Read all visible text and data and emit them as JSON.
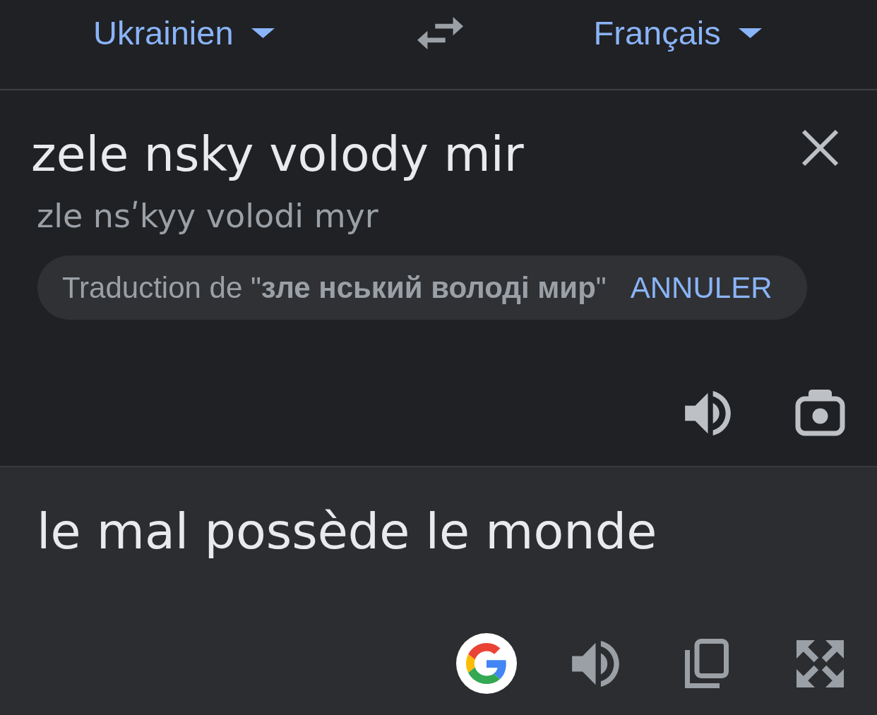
{
  "language_bar": {
    "source_language": "Ukrainien",
    "target_language": "Français"
  },
  "source": {
    "text": "zele nsky volody mir",
    "transliteration": "zle nsʹkyy volodi myr",
    "suggestion": {
      "text": "Traduction de \"**зле нський володі мир**\"",
      "action": "ANNULER"
    }
  },
  "translation": {
    "text": "le mal possède le monde"
  }
}
